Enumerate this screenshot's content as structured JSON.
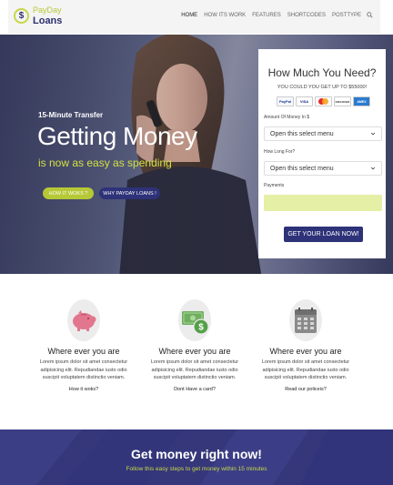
{
  "header": {
    "logo_top": "PayDay",
    "logo_bottom": "Loans",
    "logo_symbol": "$",
    "nav": [
      "HOME",
      "HOW ITS WORK",
      "FEATURES",
      "SHORTCODES",
      "POSTTYPE"
    ],
    "active_nav": "HOME",
    "search_icon": "search-icon"
  },
  "hero": {
    "subtitle": "15-Minute Transfer",
    "title": "Getting Money",
    "tagline": "is now as easy as spending",
    "btn_how": "HOW IT WOKS ?",
    "btn_why": "WHY PAYDAY LOANS !"
  },
  "loan_form": {
    "title": "How Much You Need?",
    "subtitle": "YOU COULD YOU GET UP TO $55000!",
    "cards": [
      "PayPal",
      "VISA",
      "MC",
      "DISCOVER",
      "AMEX"
    ],
    "amount_label": "Amount Of Money In $",
    "amount_value": "Open this select menu",
    "duration_label": "How Long For?",
    "duration_value": "Open this select menu",
    "payments_label": "Payments",
    "submit": "GET YOUR LOAN NOW!"
  },
  "features": [
    {
      "icon": "piggy-bank-icon",
      "title": "Where ever you are",
      "text": "Lorem ipsum dolor sit amet consectetur adipisicing elit. Repudiandae iusto odio suscipit voluptatem distinctio veniam.",
      "link": "How it woks?"
    },
    {
      "icon": "money-icon",
      "title": "Where ever you are",
      "text": "Lorem ipsum dolor sit amet consectetur adipisicing elit. Repudiandae iusto odio suscipit voluptatem distinctio veniam.",
      "link": "Dont Have a card?"
    },
    {
      "icon": "calendar-icon",
      "title": "Where ever you are",
      "text": "Lorem ipsum dolor sit amet consectetur adipisicing elit. Repudiandae iusto odio suscipit voluptatem distinctio veniam.",
      "link": "Read our policeis?"
    }
  ],
  "banner": {
    "title": "Get money right now!",
    "subtitle": "Follow this easy steps to get money within 15 minutes"
  },
  "colors": {
    "brand_navy": "#2e3278",
    "brand_lime": "#b6c836",
    "banner_bg": "#35377a"
  }
}
